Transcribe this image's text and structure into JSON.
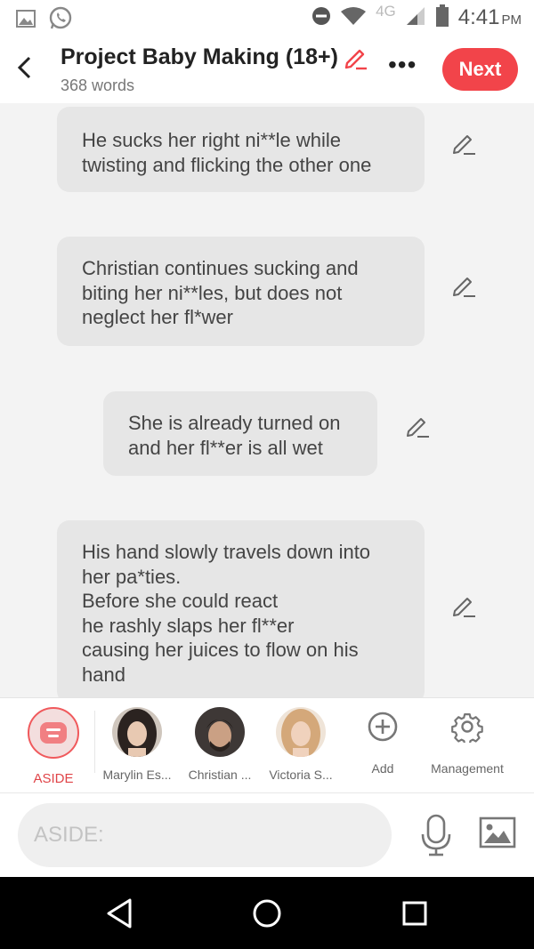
{
  "status_bar": {
    "network": "4G",
    "time": "4:41",
    "ampm": "PM",
    "icons": [
      "gallery-icon",
      "whatsapp-icon",
      "dnd-icon",
      "wifi-icon",
      "signal-icon",
      "battery-icon"
    ]
  },
  "header": {
    "title": "Project Baby Making (18+)",
    "word_count": "368 words",
    "more_label": "•••",
    "next_label": "Next",
    "accent_color": "#f2444a"
  },
  "messages": [
    {
      "text": "He sucks her right ni**le while\ntwisting and flicking the other one"
    },
    {
      "text": "Christian continues sucking and\nbiting her ni**les, but does not\nneglect her fl*wer"
    },
    {
      "text": "She is already turned on\nand her fl**er is all wet"
    },
    {
      "text": "His hand slowly travels down into\nher pa*ties.\nBefore she could react\nhe rashly slaps her fl**er\ncausing her juices to flow on his\nhand"
    }
  ],
  "characters": [
    {
      "label": "ASIDE",
      "selected": true
    },
    {
      "label": "Marylin Es..."
    },
    {
      "label": "Christian ..."
    },
    {
      "label": "Victoria S..."
    },
    {
      "label": "Add"
    },
    {
      "label": "Management"
    }
  ],
  "input": {
    "placeholder": "ASIDE:",
    "value": ""
  }
}
